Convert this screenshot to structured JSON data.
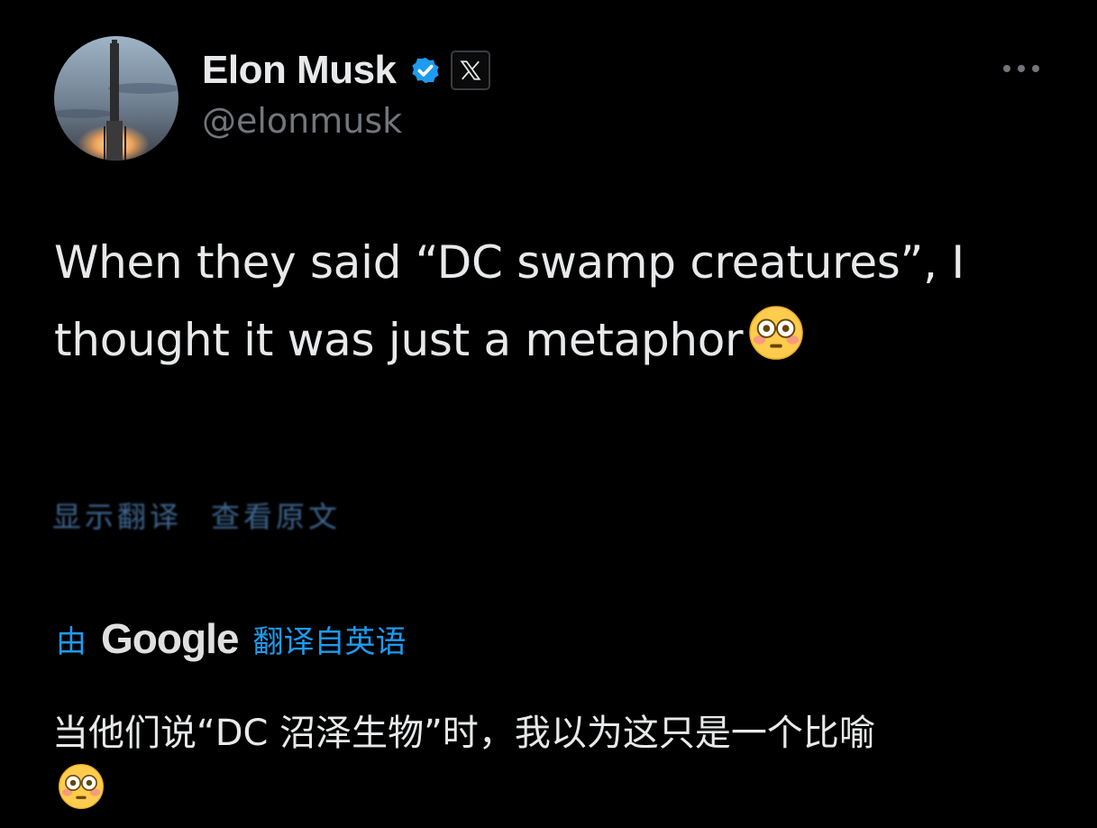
{
  "author": {
    "display_name": "Elon Musk",
    "handle": "@elonmusk",
    "avatar_icon": "rocket-launch-avatar",
    "verified_icon": "verified-badge-icon",
    "affiliation_icon": "x-logo-icon"
  },
  "more_icon": "more-options-icon",
  "tweet": {
    "text": "When they said “DC swamp creatures”, I thought it was just a metaphor",
    "emoji": "😳"
  },
  "translation": {
    "link_label_1": "显示翻译",
    "link_label_2": "查看原文",
    "by_label": "由",
    "provider": "Google",
    "source_language": "翻译自英语",
    "text": "当他们说“DC 沼泽生物”时，我以为这只是一个比喻",
    "emoji": "😳"
  },
  "colors": {
    "background": "#000000",
    "primary_text": "#e7e9ea",
    "secondary_text": "#71767b",
    "accent": "#1d9bf0"
  }
}
